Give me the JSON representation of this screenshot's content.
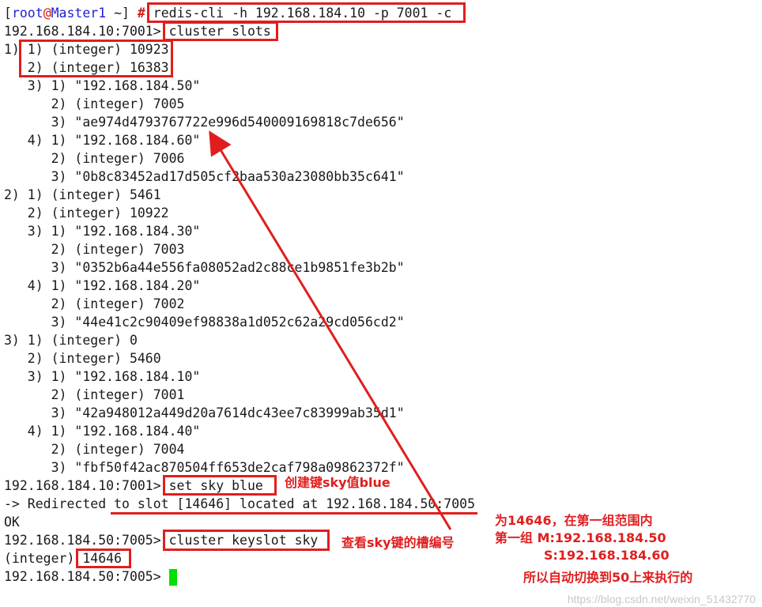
{
  "prompt": {
    "open_bracket": "[",
    "user": "root",
    "at": "@",
    "host": "Master1",
    "path": " ~",
    "close_bracket": "]",
    "hash": " # "
  },
  "commands": {
    "connect": "redis-cli -h 192.168.184.10 -p 7001 -c",
    "cluster_slots": "cluster slots",
    "set_sky": "set sky blue",
    "keyslot": "cluster keyslot sky"
  },
  "prompts": {
    "p10": "192.168.184.10:7001> ",
    "p50": "192.168.184.50:7005> "
  },
  "slots_output": [
    "1) 1) (integer) 10923",
    "   2) (integer) 16383",
    "   3) 1) \"192.168.184.50\"",
    "      2) (integer) 7005",
    "      3) \"ae974d4793767722e996d540009169818c7de656\"",
    "   4) 1) \"192.168.184.60\"",
    "      2) (integer) 7006",
    "      3) \"0b8c83452ad17d505cf2baa530a23080bb35c641\"",
    "2) 1) (integer) 5461",
    "   2) (integer) 10922",
    "   3) 1) \"192.168.184.30\"",
    "      2) (integer) 7003",
    "      3) \"0352b6a44e556fa08052ad2c88ce1b9851fe3b2b\"",
    "   4) 1) \"192.168.184.20\"",
    "      2) (integer) 7002",
    "      3) \"44e41c2c90409ef98838a1d052c62a29cd056cd2\"",
    "3) 1) (integer) 0",
    "   2) (integer) 5460",
    "   3) 1) \"192.168.184.10\"",
    "      2) (integer) 7001",
    "      3) \"42a948012a449d20a7614dc43ee7c83999ab35d1\"",
    "   4) 1) \"192.168.184.40\"",
    "      2) (integer) 7004",
    "      3) \"fbf50f42ac870504ff653de2caf798a09862372f\""
  ],
  "redirect_line": "-> Redirected to slot [14646] located at 192.168.184.50:7005",
  "ok_line": "OK",
  "integer_prefix": "(integer) ",
  "integer_value": "14646",
  "annotations": {
    "create_key": "创建键sky值blue",
    "view_slot": "查看sky键的槽编号",
    "explain_1": "为14646，在第一组范围内",
    "explain_2": "第一组 M:192.168.184.50",
    "explain_3": "S:192.168.184.60",
    "explain_4": "所以自动切换到50上来执行的"
  },
  "watermark": "https://blog.csdn.net/weixin_51432770",
  "colors": {
    "annotation": "#e01e1e",
    "cursor": "#00e000",
    "prompt_user": "#1f1fd6"
  }
}
